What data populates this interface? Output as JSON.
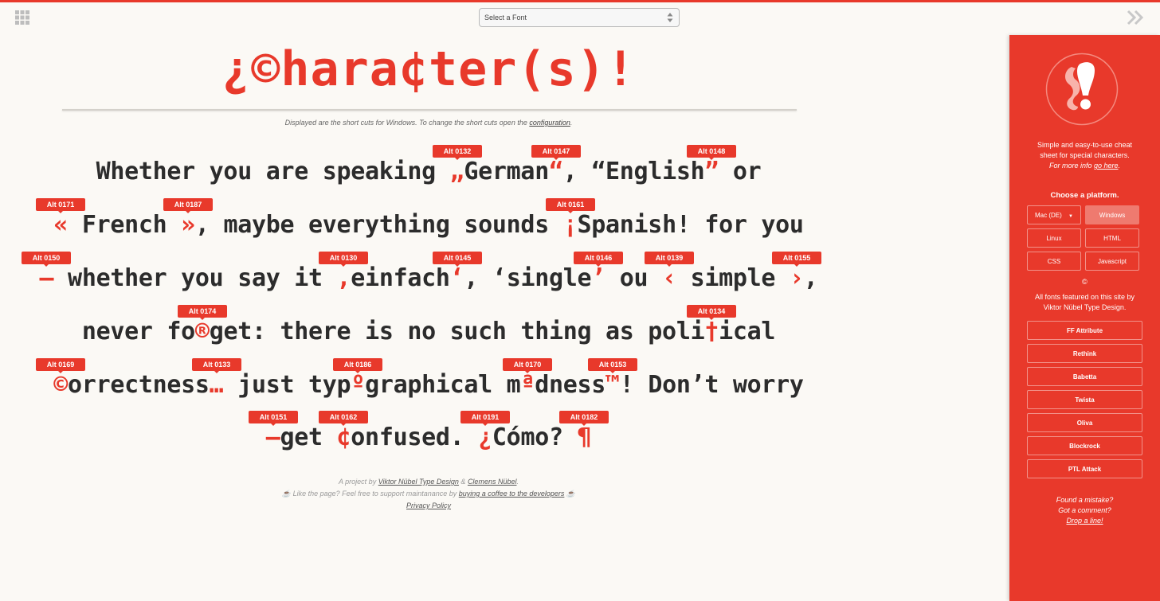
{
  "header": {
    "font_select_placeholder": "Select a Font"
  },
  "main": {
    "title_parts": [
      "¿",
      "©",
      "hara",
      "¢",
      "ter(s)!"
    ],
    "subtitle_text": "Displayed are the short cuts for Windows. To change the short cuts open the ",
    "subtitle_link": "configuration",
    "subtitle_end": ".",
    "lines": [
      {
        "segments": [
          {
            "t": "Whether you are speaking "
          },
          {
            "t": "„",
            "s": true
          },
          {
            "t": "German"
          },
          {
            "t": "“",
            "s": true
          },
          {
            "t": ", “English"
          },
          {
            "t": "”",
            "s": true
          },
          {
            "t": " or"
          }
        ],
        "badges": [
          "Alt 0132",
          "Alt 0147",
          "Alt 0148"
        ]
      },
      {
        "segments": [
          {
            "t": "«",
            "s": true
          },
          {
            "t": " French "
          },
          {
            "t": "»",
            "s": true
          },
          {
            "t": ", maybe everything sounds "
          },
          {
            "t": "¡",
            "s": true
          },
          {
            "t": "Spanish! for you"
          }
        ],
        "badges": [
          "Alt 0171",
          "Alt 0187",
          "Alt 0161"
        ]
      },
      {
        "segments": [
          {
            "t": "–",
            "s": true
          },
          {
            "t": " whether you say it "
          },
          {
            "t": "‚",
            "s": true
          },
          {
            "t": "einfach"
          },
          {
            "t": "‘",
            "s": true
          },
          {
            "t": ", ‘single"
          },
          {
            "t": "’",
            "s": true
          },
          {
            "t": " ou "
          },
          {
            "t": "‹",
            "s": true
          },
          {
            "t": " simple "
          },
          {
            "t": "›",
            "s": true
          },
          {
            "t": ","
          }
        ],
        "badges": [
          "Alt 0150",
          "Alt 0130",
          "Alt 0145",
          "Alt 0146",
          "Alt 0139",
          "Alt 0155"
        ]
      },
      {
        "segments": [
          {
            "t": "never fo"
          },
          {
            "t": "®",
            "s": true
          },
          {
            "t": "get: there is no such thing as poli"
          },
          {
            "t": "†",
            "s": true
          },
          {
            "t": "ical"
          }
        ],
        "badges": [
          "Alt 0174",
          "Alt 0134"
        ]
      },
      {
        "segments": [
          {
            "t": "©",
            "s": true
          },
          {
            "t": "orrectness"
          },
          {
            "t": "…",
            "s": true
          },
          {
            "t": " just typ"
          },
          {
            "t": "º",
            "s": true
          },
          {
            "t": "graphical m"
          },
          {
            "t": "ª",
            "s": true
          },
          {
            "t": "dness"
          },
          {
            "t": "™",
            "s": true
          },
          {
            "t": "! Don’t worry"
          }
        ],
        "badges": [
          "Alt 0169",
          "Alt 0133",
          "Alt 0186",
          "Alt 0170",
          "Alt 0153"
        ]
      },
      {
        "segments": [
          {
            "t": "—",
            "s": true
          },
          {
            "t": "get "
          },
          {
            "t": "¢",
            "s": true
          },
          {
            "t": "onfused. "
          },
          {
            "t": "¿",
            "s": true
          },
          {
            "t": "Cómo? "
          },
          {
            "t": "¶",
            "s": true
          }
        ],
        "badges": [
          "Alt 0151",
          "Alt 0162",
          "Alt 0191",
          "Alt 0182"
        ]
      }
    ],
    "footer": {
      "line1_prefix": "A project by ",
      "link_viktor": "Viktor Nübel Type Design",
      "amp": " & ",
      "link_clemens": "Clemens Nübel",
      "line1_end": ".",
      "line2_prefix": "☕ Like the page? Feel free to support maintanance by ",
      "link_coffee": "buying a coffee to the developers",
      "line2_end": " ☕",
      "link_privacy": "Privacy Policy"
    }
  },
  "sidebar": {
    "tagline_1": "Simple and easy-to-use cheat",
    "tagline_2": "sheet for special characters.",
    "more_info_prefix": "For more info ",
    "more_info_link": "go here",
    "more_info_end": ".",
    "choose_platform": "Choose a platform.",
    "platforms": [
      "Mac (DE)",
      "Windows",
      "Linux",
      "HTML",
      "CSS",
      "Javascript"
    ],
    "active_platform": "Windows",
    "copyright_symbol": "©",
    "fonts_note_1": "All fonts featured on this site by",
    "fonts_note_2": "Viktor Nübel Type Design.",
    "fonts": [
      "FF Attribute",
      "Rethink",
      "Babetta",
      "Twista",
      "Oliva",
      "Blockrock",
      "PTL Attack"
    ],
    "mistake_1": "Found a mistake?",
    "mistake_2": "Got a comment?",
    "mistake_link": "Drop a line!"
  },
  "colors": {
    "accent": "#e8392b",
    "text": "#2c2c2c",
    "background": "#fbf9f5"
  },
  "icons": [
    "grid-menu-icon",
    "chevron-double-right-icon",
    "select-arrows-icon",
    "exclamation-logo-icon"
  ]
}
